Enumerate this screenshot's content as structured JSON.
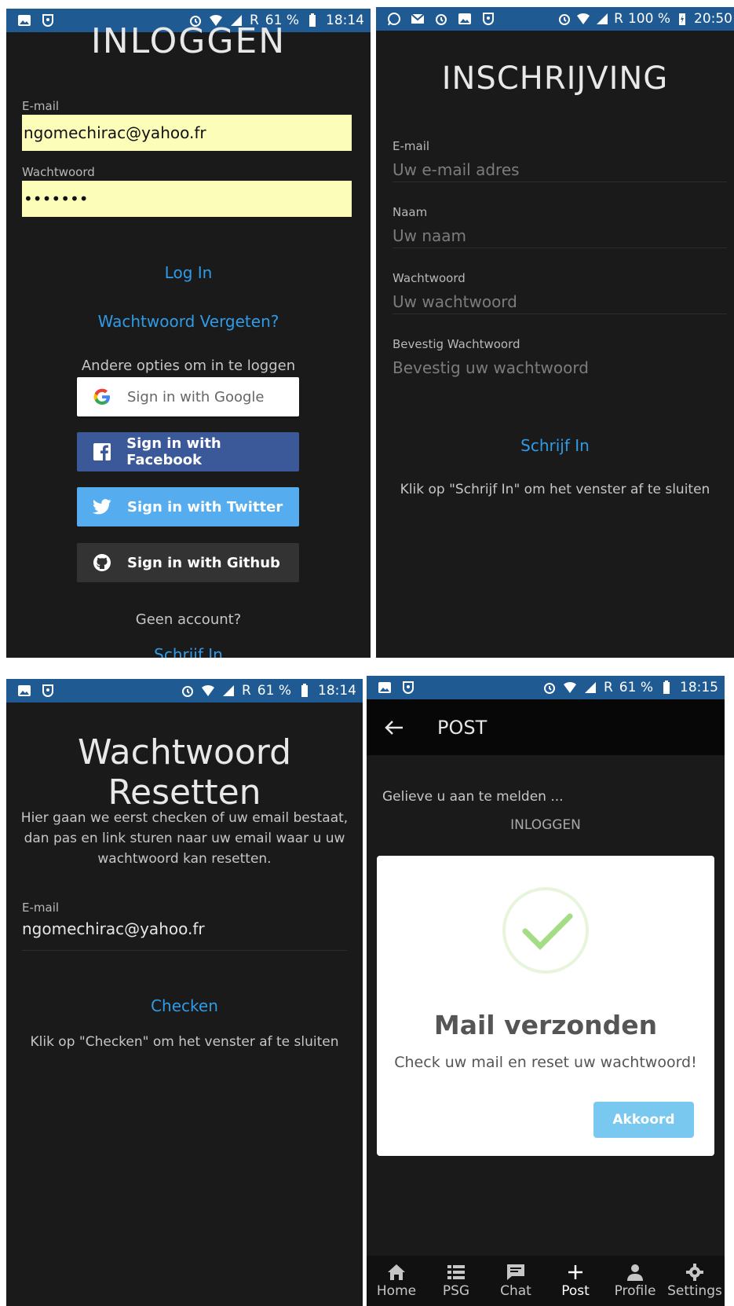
{
  "status_bars": {
    "s1": {
      "battery": "61 %",
      "time": "18:14",
      "roaming": "R"
    },
    "s2": {
      "battery": "100 %",
      "time": "20:50",
      "roaming": "R"
    },
    "s3": {
      "battery": "61 %",
      "time": "18:14",
      "roaming": "R"
    },
    "s4": {
      "battery": "61 %",
      "time": "18:15",
      "roaming": "R"
    }
  },
  "login": {
    "title": "INLOGGEN",
    "email_label": "E-mail",
    "email_value": "ngomechirac@yahoo.fr",
    "password_label": "Wachtwoord",
    "password_value": "•••••••",
    "login_link": "Log In",
    "forgot_link": "Wachtwoord Vergeten?",
    "other_options": "Andere opties om in te loggen",
    "google": "Sign in with Google",
    "facebook": "Sign in with Facebook",
    "twitter": "Sign in with Twitter",
    "github": "Sign in with Github",
    "no_account": "Geen account?",
    "signup_link": "Schrijf In"
  },
  "register": {
    "title": "INSCHRIJVING",
    "email_label": "E-mail",
    "email_placeholder": "Uw e-mail adres",
    "name_label": "Naam",
    "name_placeholder": "Uw naam",
    "password_label": "Wachtwoord",
    "password_placeholder": "Uw wachtwoord",
    "confirm_label": "Bevestig Wachtwoord",
    "confirm_placeholder": "Bevestig uw wachtwoord",
    "submit": "Schrijf In",
    "hint": "Klik op \"Schrijf In\" om het venster af te sluiten"
  },
  "reset": {
    "title": "Wachtwoord Resetten",
    "description": "Hier gaan we eerst checken of uw email bestaat, dan pas en link sturen naar uw email waar u uw wachtwoord kan resetten.",
    "email_label": "E-mail",
    "email_value": "ngomechirac@yahoo.fr",
    "submit": "Checken",
    "hint": "Klik op \"Checken\" om het venster af te sluiten"
  },
  "post": {
    "title": "POST",
    "please_login": "Gelieve u aan te melden ...",
    "login_link": "INLOGGEN",
    "modal": {
      "title": "Mail verzonden",
      "text": "Check uw mail en reset uw wachtwoord!",
      "button": "Akkoord"
    },
    "nav": [
      {
        "label": "Home",
        "icon": "home-icon"
      },
      {
        "label": "PSG",
        "icon": "list-icon"
      },
      {
        "label": "Chat",
        "icon": "chat-icon"
      },
      {
        "label": "Post",
        "icon": "plus-icon"
      },
      {
        "label": "Profile",
        "icon": "person-icon"
      },
      {
        "label": "Settings",
        "icon": "gear-icon"
      }
    ]
  },
  "colors": {
    "status_bar": "#1f5a92",
    "background": "#1a1a1b",
    "link": "#2f9be6",
    "autofill": "#fbfdb9",
    "facebook": "#3b5998",
    "twitter": "#55acee",
    "github": "#333333",
    "success": "#a5dc86",
    "confirm_button": "#79c8ef"
  }
}
